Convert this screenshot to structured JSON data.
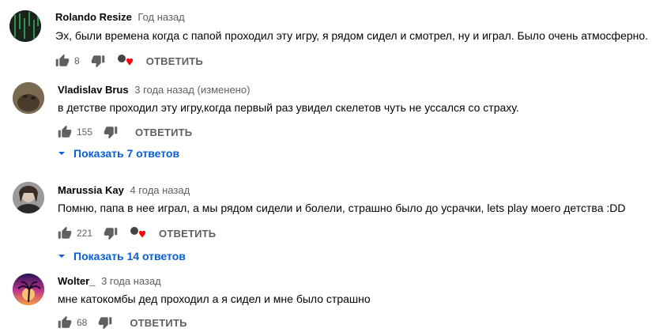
{
  "comments": [
    {
      "author": "Rolando Resize",
      "time": "Год назад",
      "text": "Эх, были времена когда с папой проходил эту игру, я рядом сидел и смотрел, ну и играл. Было очень атмосферно.",
      "likes": "8",
      "reply_label": "ОТВЕТИТЬ",
      "heart": true
    },
    {
      "author": "Vladislav Brus",
      "time": "3 года назад (изменено)",
      "text": "в детстве проходил эту игру,когда первый раз увидел скелетов чуть не уссался со страху.",
      "likes": "155",
      "reply_label": "ОТВЕТИТЬ",
      "heart": false,
      "show_replies": "Показать 7 ответов"
    },
    {
      "author": "Marussia Kay",
      "time": "4 года назад",
      "text": "Помню, папа в нее играл, а мы рядом сидели и болели, страшно было до усрачки, lets play моего детства :DD",
      "likes": "221",
      "reply_label": "ОТВЕТИТЬ",
      "heart": true,
      "show_replies": "Показать 14 ответов"
    },
    {
      "author": "Wolter_",
      "time": "3 года назад",
      "text": "мне катокомбы дед проходил а я сидел и мне было страшно",
      "likes": "68",
      "reply_label": "ОТВЕТИТЬ",
      "heart": false
    }
  ],
  "colors": {
    "link_blue": "#065fd4",
    "heart_red": "#ff0000",
    "meta_gray": "#606060"
  }
}
